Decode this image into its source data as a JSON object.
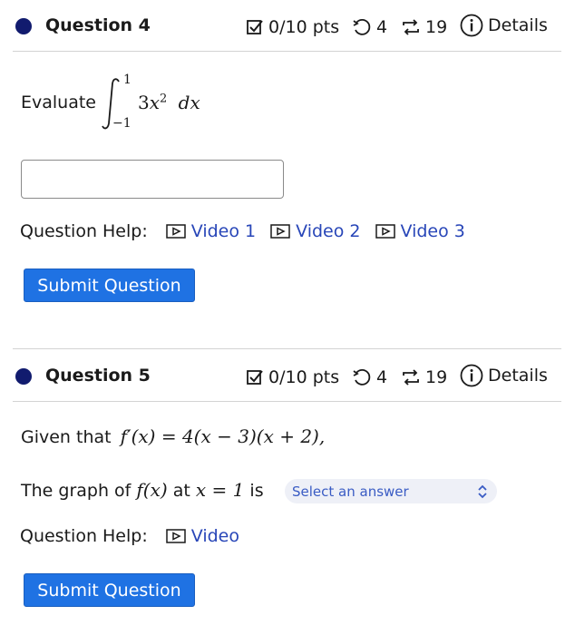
{
  "question4": {
    "title": "Question 4",
    "points": "0/10 pts",
    "retries": "4",
    "attempts": "19",
    "details": "Details",
    "prompt": "Evaluate",
    "integral_upper": "1",
    "integral_lower": "−1",
    "integrand_coef": "3",
    "integrand_var": "x",
    "integrand_exp": "2",
    "integrand_d": "dx",
    "answer_value": "",
    "help_label": "Question Help:",
    "videos": [
      "Video 1",
      "Video 2",
      "Video 3"
    ],
    "submit_label": "Submit Question"
  },
  "question5": {
    "title": "Question 5",
    "points": "0/10 pts",
    "retries": "4",
    "attempts": "19",
    "details": "Details",
    "given_prefix": "Given that",
    "given_expr": "f′(x) = 4(x − 3)(x + 2),",
    "graph_prefix": "The graph of",
    "graph_fx": "f(x)",
    "graph_at": "at",
    "graph_x1": "x = 1",
    "graph_is": "is",
    "select_placeholder": "Select an answer",
    "help_label": "Question Help:",
    "video": "Video",
    "submit_label": "Submit Question"
  },
  "colors": {
    "dot": "#111b6e",
    "link": "#2846b8",
    "submit_bg": "#1f72e3",
    "divider": "#d3d3d3"
  },
  "icons": {
    "points": "checkbox-icon",
    "retries": "retry-icon",
    "attempts": "repeat-icon",
    "details": "info-icon",
    "video": "play-icon",
    "select": "chevron-updown-icon"
  }
}
